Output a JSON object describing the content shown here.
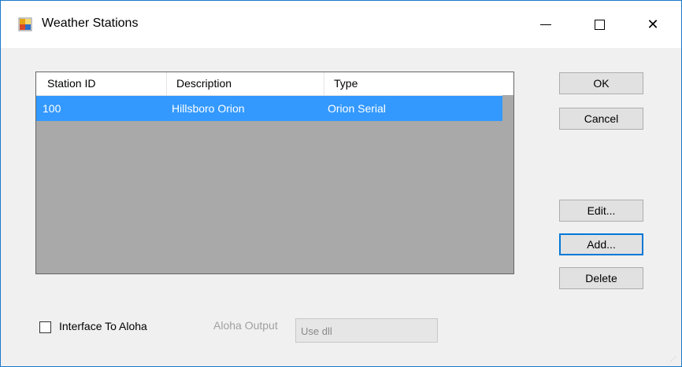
{
  "window": {
    "title": "Weather Stations",
    "icon": "app-window-icon"
  },
  "titlebar_buttons": {
    "minimize": "minimize-icon",
    "maximize": "maximize-icon",
    "close_glyph": "✕"
  },
  "listview": {
    "columns": [
      "Station ID",
      "Description",
      "Type"
    ],
    "rows": [
      {
        "station_id": "100",
        "description": "Hillsboro Orion",
        "type": "Orion Serial",
        "selected": true
      }
    ],
    "selection_color": "#3399ff",
    "background_color": "#a9a9a9"
  },
  "buttons": {
    "ok": "OK",
    "cancel": "Cancel",
    "edit": "Edit...",
    "add": "Add...",
    "delete": "Delete"
  },
  "options": {
    "interface_label": "Interface To Aloha",
    "interface_checked": false,
    "aloha_output_label": "Aloha Output",
    "aloha_output_value": "Use dll"
  }
}
